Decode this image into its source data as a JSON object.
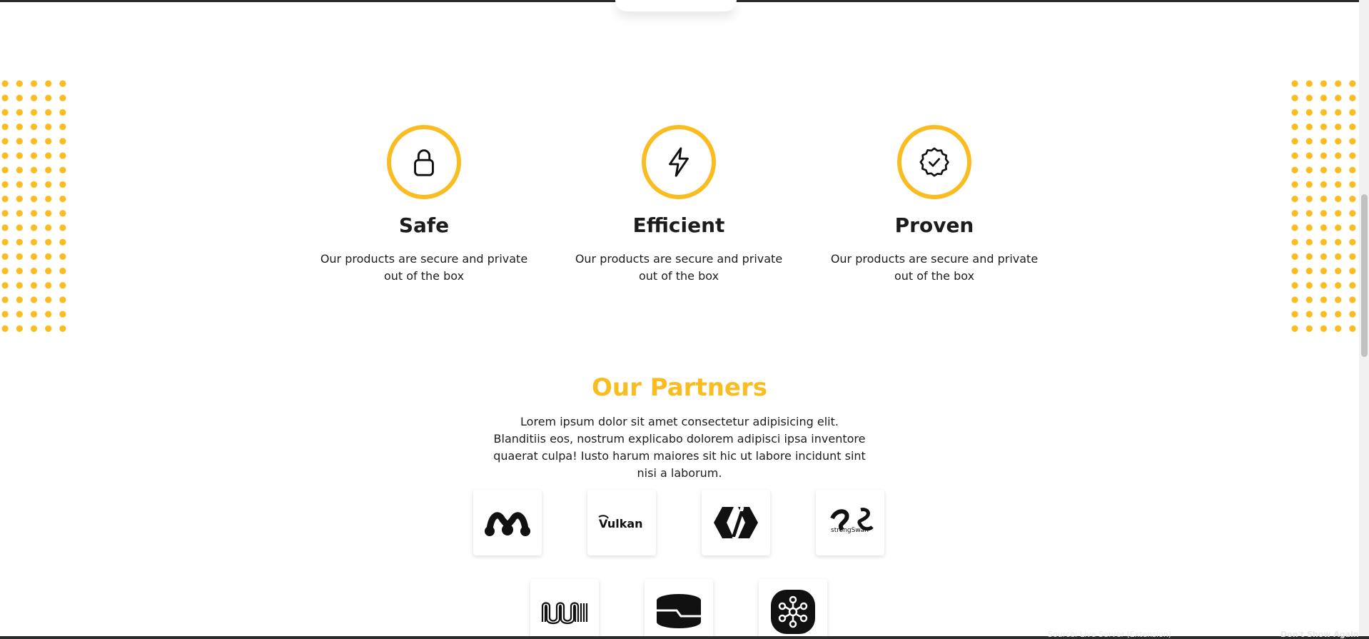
{
  "features": [
    {
      "icon": "lock-icon",
      "title": "Safe",
      "description": "Our products are secure and private out of the box"
    },
    {
      "icon": "lightning-icon",
      "title": "Efficient",
      "description": "Our products are secure and private out of the box"
    },
    {
      "icon": "verified-badge-icon",
      "title": "Proven",
      "description": "Our products are secure and private out of the box"
    }
  ],
  "partners": {
    "title": "Our Partners",
    "description": "Lorem ipsum dolor sit amet consectetur adipisicing elit. Blanditiis eos, nostrum explicabo dolorem adipisci ipsa inventore quaerat culpa! Iusto harum maiores sit hic ut labore incidunt sint nisi a laborum.",
    "logos": [
      {
        "name": "mendeley-logo",
        "label": ""
      },
      {
        "name": "vulkan-logo",
        "label": "Vulkan"
      },
      {
        "name": "polymer-logo",
        "label": ""
      },
      {
        "name": "strongswan-logo",
        "label": "strongSwan"
      },
      {
        "name": "muni-logo",
        "label": ""
      },
      {
        "name": "stackshare-logo",
        "label": ""
      },
      {
        "name": "kubeflow-logo",
        "label": ""
      }
    ]
  },
  "colors": {
    "accent": "#f9bd21",
    "text": "#1c1c1c",
    "background": "#ffffff"
  },
  "bottom_bar": {
    "source_text": "Source: Live Server (Extension)",
    "action_text": "Don't Show Again"
  }
}
